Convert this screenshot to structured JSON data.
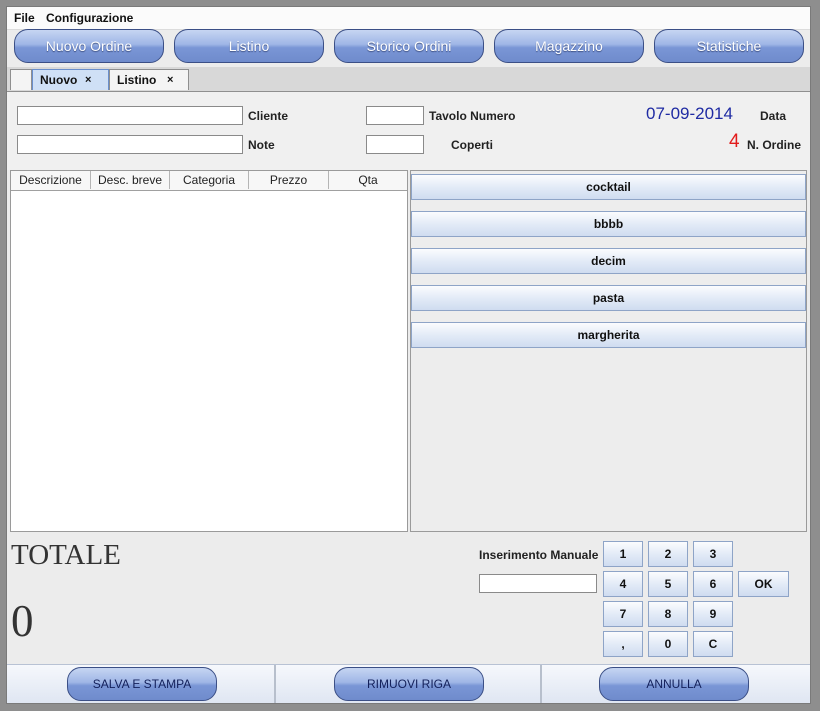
{
  "menu": {
    "file": "File",
    "config": "Configurazione"
  },
  "nav": [
    "Nuovo Ordine",
    "Listino",
    "Storico Ordini",
    "Magazzino",
    "Statistiche"
  ],
  "tabs": [
    {
      "label": "Nuovo",
      "close": "×",
      "active": true
    },
    {
      "label": "Listino",
      "close": "×",
      "active": false
    }
  ],
  "form": {
    "cliente_label": "Cliente",
    "note_label": "Note",
    "tavolo_label": "Tavolo Numero",
    "coperti_label": "Coperti",
    "data_label": "Data",
    "data_value": "07-09-2014",
    "ordine_label": "N. Ordine",
    "ordine_value": "4"
  },
  "table": {
    "columns": [
      "Descrizione",
      "Desc. breve",
      "Categoria",
      "Prezzo",
      "Qta"
    ]
  },
  "products": [
    "cocktail",
    "bbbb",
    "decim",
    "pasta",
    "margherita"
  ],
  "total": {
    "label": "TOTALE",
    "value": "0"
  },
  "manual": {
    "label": "Inserimento Manuale",
    "ok": "OK"
  },
  "keypad": [
    "1",
    "2",
    "3",
    "4",
    "5",
    "6",
    "7",
    "8",
    "9",
    ",",
    "0",
    "C"
  ],
  "actions": [
    "SALVA E STAMPA",
    "RIMUOVI RIGA",
    "ANNULLA"
  ],
  "colors": {
    "accent_blue": "#7a96d6",
    "date_color": "#1f2ba3",
    "order_color": "#e21c1c"
  }
}
